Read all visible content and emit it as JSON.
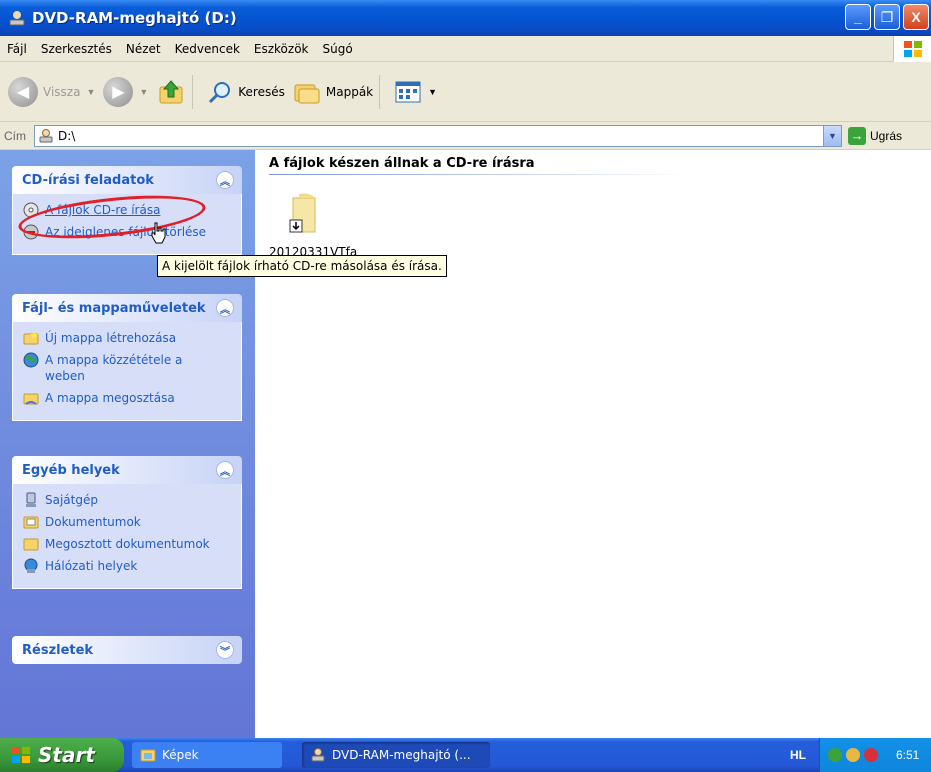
{
  "window": {
    "title": "DVD-RAM-meghajtó (D:)",
    "minimize": "_",
    "maximize": "❐",
    "close": "X"
  },
  "menu": [
    "Fájl",
    "Szerkesztés",
    "Nézet",
    "Kedvencek",
    "Eszközök",
    "Súgó"
  ],
  "toolbar": {
    "back": "Vissza",
    "search": "Keresés",
    "folders": "Mappák"
  },
  "address": {
    "label": "Cím",
    "value": "D:\\",
    "go": "Ugrás"
  },
  "taskpane": {
    "panels": [
      {
        "title": "CD-írási feladatok",
        "chevron": "up",
        "items": [
          "A fájlok CD-re írása",
          "Az ideiglenes fájlok törlése"
        ]
      },
      {
        "title": "Fájl- és mappaműveletek",
        "chevron": "up",
        "items": [
          "Új mappa létrehozása",
          "A mappa közzététele a weben",
          "A mappa megosztása"
        ]
      },
      {
        "title": "Egyéb helyek",
        "chevron": "up",
        "items": [
          "Sajátgép",
          "Dokumentumok",
          "Megosztott dokumentumok",
          "Hálózati helyek"
        ]
      },
      {
        "title": "Részletek",
        "chevron": "down",
        "items": []
      }
    ]
  },
  "main": {
    "group_header": "A fájlok készen állnak a CD-re írásra",
    "files": [
      {
        "name": "20120331VTfa",
        "icon": "folder-write-icon"
      }
    ]
  },
  "tooltip": "A kijelölt fájlok írható CD-re másolása és írása.",
  "taskbar": {
    "start": "Start",
    "buttons": [
      "Képek",
      "DVD-RAM-meghajtó (..."
    ],
    "lang": "HL",
    "clock": "6:51"
  },
  "colors": {
    "title_blue": "#0553d2",
    "taskpane_link": "#215dc6",
    "annotation_red": "#e0202a",
    "start_green": "#3a9a3a"
  }
}
